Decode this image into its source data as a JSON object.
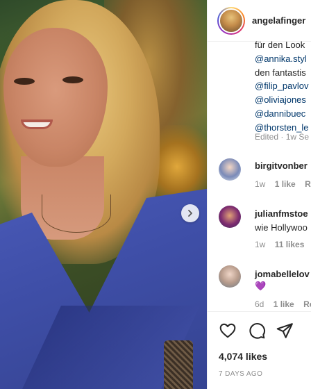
{
  "post": {
    "next_button_icon": "chevron-right-icon",
    "author": "angelafinger"
  },
  "caption": {
    "line1": "für den Look",
    "mention1": "@annika.styl",
    "line2": "den fantastis",
    "mentions": [
      "@filip_pavlov",
      "@oliviajones",
      "@dannibuec",
      "@thorsten_le"
    ],
    "meta": "Edited · 1w  Se"
  },
  "comments": [
    {
      "user": "birgitvonber",
      "text": "",
      "time": "1w",
      "likes": "1 like",
      "reply": "Re"
    },
    {
      "user": "julianfmstoe",
      "text": "wie Hollywoo",
      "time": "1w",
      "likes": "11 likes",
      "reply": "R"
    },
    {
      "user": "jomabellelov",
      "text": "💜",
      "time": "6d",
      "likes": "1 like",
      "reply": "Re"
    }
  ],
  "actions": {
    "like_icon": "heart-icon",
    "comment_icon": "comment-icon",
    "share_icon": "send-icon",
    "likes_count": "4,074 likes",
    "posted": "7 DAYS AGO"
  },
  "colors": {
    "link": "#00376b",
    "text": "#262626",
    "muted": "#8e8e8e"
  }
}
